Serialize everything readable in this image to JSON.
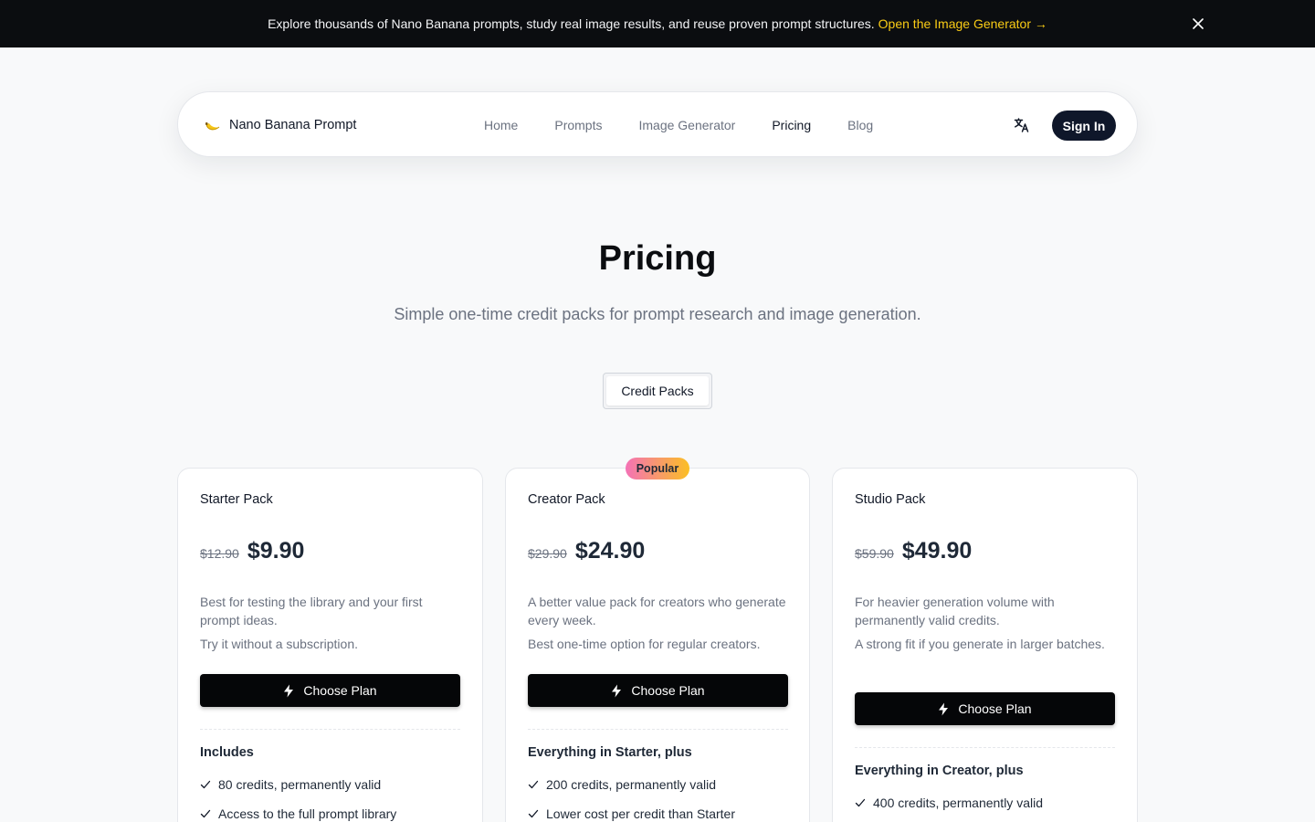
{
  "announcement": {
    "text": "Explore thousands of Nano Banana prompts, study real image results, and reuse proven prompt structures.",
    "link": "Open the Image Generator →"
  },
  "header": {
    "brand": "Nano Banana Prompt",
    "nav": [
      "Home",
      "Prompts",
      "Image Generator",
      "Pricing",
      "Blog"
    ],
    "active": "Pricing",
    "sign_in": "Sign In"
  },
  "hero": {
    "title": "Pricing",
    "subtitle": "Simple one-time credit packs for prompt research and image generation.",
    "tab": "Credit Packs"
  },
  "plans": [
    {
      "name": "Starter Pack",
      "old_price": "$12.90",
      "price": "$9.90",
      "description": "Best for testing the library and your first prompt ideas.",
      "note": "Try it without a subscription.",
      "cta": "Choose Plan",
      "includes_title": "Includes",
      "features": [
        "80 credits, permanently valid",
        "Access to the full prompt library"
      ]
    },
    {
      "name": "Creator Pack",
      "badge": "Popular",
      "old_price": "$29.90",
      "price": "$24.90",
      "description": "A better value pack for creators who generate every week.",
      "note": "Best one-time option for regular creators.",
      "cta": "Choose Plan",
      "includes_title": "Everything in Starter, plus",
      "features": [
        "200 credits, permanently valid",
        "Lower cost per credit than Starter"
      ]
    },
    {
      "name": "Studio Pack",
      "old_price": "$59.90",
      "price": "$49.90",
      "description": "For heavier generation volume with permanently valid credits.",
      "note": "A strong fit if you generate in larger batches.",
      "cta": "Choose Plan",
      "includes_title": "Everything in Creator, plus",
      "features": [
        "400 credits, permanently valid"
      ]
    }
  ],
  "colors": {
    "announcement_bg": "#0b0d10",
    "link_accent": "#facc15",
    "button_dark": "#050608",
    "badge_gradient": [
      "#f472b6",
      "#fbbf24"
    ]
  },
  "icons": [
    "close-icon",
    "banana-icon",
    "translate-icon",
    "bolt-icon",
    "check-icon"
  ]
}
